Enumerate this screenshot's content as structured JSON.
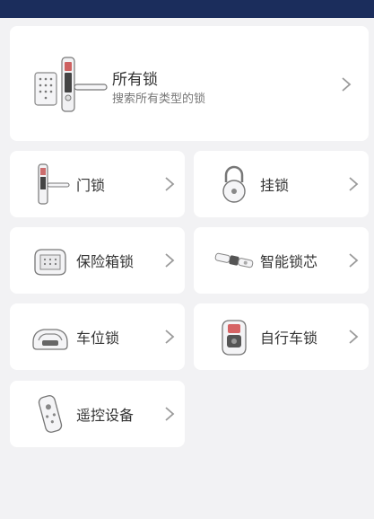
{
  "status_bar": {},
  "all_locks": {
    "title": "所有锁",
    "subtitle": "搜索所有类型的锁",
    "icon": "smart-door-lock-icon"
  },
  "categories": [
    {
      "label": "门锁",
      "icon": "door-lock-icon"
    },
    {
      "label": "挂锁",
      "icon": "padlock-icon"
    },
    {
      "label": "保险箱锁",
      "icon": "safe-lock-icon"
    },
    {
      "label": "智能锁芯",
      "icon": "lock-cylinder-icon"
    },
    {
      "label": "车位锁",
      "icon": "parking-lock-icon"
    },
    {
      "label": "自行车锁",
      "icon": "bike-lock-icon"
    },
    {
      "label": "遥控设备",
      "icon": "remote-control-icon"
    }
  ],
  "colors": {
    "header": "#1b2d5c",
    "background": "#f2f2f4",
    "card": "#ffffff",
    "chevron": "#9a9a9a"
  }
}
